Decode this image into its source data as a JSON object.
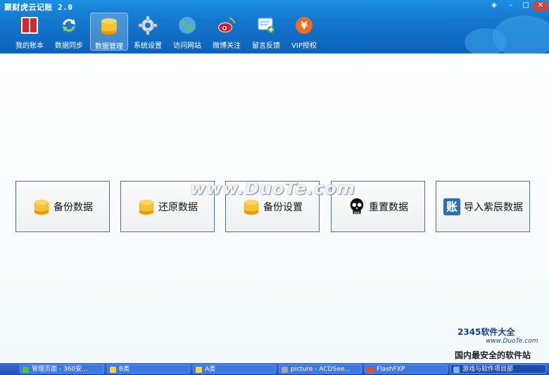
{
  "window": {
    "title": "聚财虎云记账 2.0",
    "controls": [
      "minimize",
      "maximize",
      "close"
    ]
  },
  "toolbar": [
    {
      "label": "我的账本",
      "icon": "ledger-book-icon"
    },
    {
      "label": "数据同步",
      "icon": "sync-icon"
    },
    {
      "label": "数据管理",
      "icon": "coin-stack-icon",
      "active": true
    },
    {
      "label": "系统设置",
      "icon": "gear-icon"
    },
    {
      "label": "访问网站",
      "icon": "globe-icon"
    },
    {
      "label": "微博关注",
      "icon": "weibo-icon"
    },
    {
      "label": "留言反馈",
      "icon": "feedback-icon"
    },
    {
      "label": "VIP授权",
      "icon": "yen-coin-icon"
    }
  ],
  "actions": [
    {
      "label": "备份数据",
      "icon": "coin-stack-icon"
    },
    {
      "label": "还原数据",
      "icon": "coin-stack-icon"
    },
    {
      "label": "备份设置",
      "icon": "coin-stack-icon"
    },
    {
      "label": "重置数据",
      "icon": "skull-icon"
    },
    {
      "label": "导入紫辰数据",
      "icon": "zhang-badge-icon",
      "badge": "账"
    }
  ],
  "watermarks": {
    "center": "www.DuoTe.com",
    "corner_brand": "2345软件大全",
    "corner_url": "www.DuoTe.com",
    "corner_slogan": "国内最安全的软件站"
  },
  "taskbar": [
    {
      "label": "管理页面 - 360安..."
    },
    {
      "label": "B类"
    },
    {
      "label": "A类"
    },
    {
      "label": "picture - ACDSee..."
    },
    {
      "label": "FlashFXP"
    },
    {
      "label": "游戏与软件项目部"
    }
  ]
}
